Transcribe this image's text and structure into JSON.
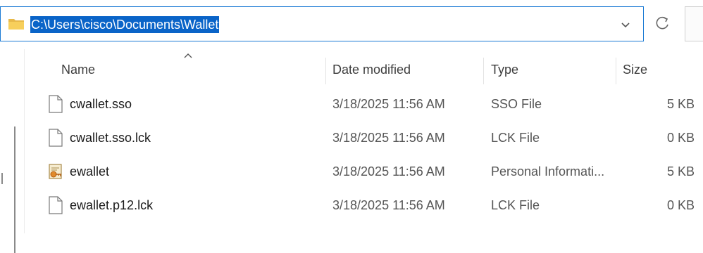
{
  "address_bar": {
    "path": "C:\\Users\\cisco\\Documents\\Wallet",
    "folder_icon": "folder-icon",
    "dropdown_icon": "chevron-down-icon",
    "selection_color": "#0a64c8"
  },
  "toolbar": {
    "refresh_icon": "refresh-icon"
  },
  "list": {
    "sort_indicator_icon": "sort-ascending-icon",
    "columns": {
      "name": "Name",
      "date": "Date modified",
      "type": "Type",
      "size": "Size"
    },
    "rows": [
      {
        "name": "cwallet.sso",
        "date": "3/18/2025 11:56 AM",
        "type": "SSO File",
        "size": "5 KB",
        "icon": "blank-file-icon"
      },
      {
        "name": "cwallet.sso.lck",
        "date": "3/18/2025 11:56 AM",
        "type": "LCK File",
        "size": "0 KB",
        "icon": "blank-file-icon"
      },
      {
        "name": "ewallet",
        "date": "3/18/2025 11:56 AM",
        "type": "Personal Informati...",
        "size": "5 KB",
        "icon": "certificate-file-icon"
      },
      {
        "name": "ewallet.p12.lck",
        "date": "3/18/2025 11:56 AM",
        "type": "LCK File",
        "size": "0 KB",
        "icon": "blank-file-icon"
      }
    ]
  }
}
